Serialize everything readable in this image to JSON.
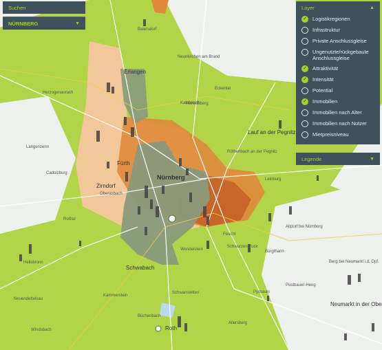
{
  "search": {
    "label": "Suchen",
    "selected": "NÜRNBERG"
  },
  "layer_panel": {
    "title": "Layer",
    "items": [
      {
        "label": "Logistikregionen",
        "checked": true
      },
      {
        "label": "Infrastruktur",
        "checked": false
      },
      {
        "label": "Private Anschlussgleise",
        "checked": false
      },
      {
        "label": "Ungenutzte/rückgebaute Anschlussgleise",
        "checked": false
      },
      {
        "label": "Attraktivität",
        "checked": true
      },
      {
        "label": "Intensität",
        "checked": true
      },
      {
        "label": "Potential",
        "checked": false
      },
      {
        "label": "Immobilien",
        "checked": true
      },
      {
        "label": "Immobilien nach Alter",
        "checked": false
      },
      {
        "label": "Immobilien nach Nutzer",
        "checked": false
      },
      {
        "label": "Mietpreisniveau",
        "checked": false
      }
    ]
  },
  "legend": {
    "title": "Legende"
  },
  "map_labels": {
    "nuernberg": "Nürnberg",
    "erlangen": "Erlangen",
    "fuerth": "Fürth",
    "zirndorf": "Zirndorf",
    "oberasbach": "Oberasbach",
    "schwabach": "Schwabach",
    "herzogenaurach": "Herzogenaurach",
    "langenzenn": "Langenzenn",
    "cadolzburg": "Cadolzburg",
    "rosstal": "Roßtal",
    "heilsbronn": "Heilsbronn",
    "neuendettelsau": "Neuendettelsau",
    "windsbach": "Windsbach",
    "roth": "Roth",
    "allersberg": "Allersberg",
    "feucht": "Feucht",
    "wendelstein": "Wendelstein",
    "schwarzenbruck": "Schwarzenbruck",
    "pyrbaum": "Pyrbaum",
    "burgthann": "Burgthann",
    "altdorf": "Altdorf bei Nürnberg",
    "lauf": "Lauf an der Pegnitz",
    "leinburg": "Leinburg",
    "neumarkt": "Neumarkt in der Oberpfalz",
    "postbauer": "Postbauer-Heng",
    "berg": "Berg bei Neumarkt i.d. Opf.",
    "heroldsberg": "Heroldsberg",
    "eckental": "Eckental",
    "neunkirchen": "Neunkirchen am Brand",
    "baiersdorf": "Baiersdorf",
    "kalchreuth": "Kalchreuth",
    "roethenbach": "Röthenbach an der Pegnitz",
    "schwanstetten": "Schwanstetten",
    "kammerstein": "Kammerstein",
    "buechenbach": "Büchenbach"
  },
  "colors": {
    "map_bg": "#eef0ee",
    "green": "#a6cf2a",
    "grey_region": "#8a9a7c",
    "orange": "#e08a3a",
    "dark_orange": "#c8662a",
    "peach": "#f2c79a",
    "water": "#b9d7ee"
  }
}
